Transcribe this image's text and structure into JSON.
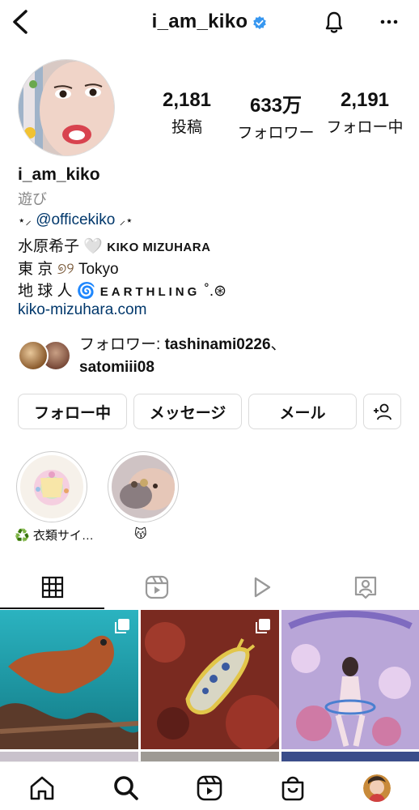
{
  "header": {
    "back_label": "‹",
    "username": "i_am_kiko",
    "verified": true
  },
  "profile": {
    "name": "i_am_kiko",
    "category": "遊び",
    "stats": [
      {
        "value": "2,181",
        "label": "投稿"
      },
      {
        "value": "633万",
        "label": "フォロワー"
      },
      {
        "value": "2,191",
        "label": "フォロー中"
      }
    ],
    "bio": {
      "line1_pre": "⋆",
      "mention": "@officekiko",
      "line2_jp": "水原希子",
      "line2_heart": "🤍",
      "line2_en": "KIKO MIZUHARA",
      "line3_jp": "東 京",
      "line3_sym": "୭୨",
      "line3_en": "Tokyo",
      "line4_jp": "地 球 人",
      "line4_sym": "🌀",
      "line4_en": "EARTHLING",
      "line4_tail": "˚.⊛",
      "website": "kiko-mizuhara.com"
    },
    "followed_by": {
      "prefix": "フォロワー: ",
      "user1": "tashinami0226",
      "sep": "、",
      "user2": "satomiii08"
    }
  },
  "actions": {
    "following": "フォロー中",
    "message": "メッセージ",
    "email": "メール"
  },
  "highlights": [
    {
      "label": "♻️ 衣類サイ…"
    },
    {
      "label": "😽"
    }
  ],
  "colors": {
    "verified": "#3797f0",
    "link": "#00376b",
    "muted": "#888888"
  }
}
